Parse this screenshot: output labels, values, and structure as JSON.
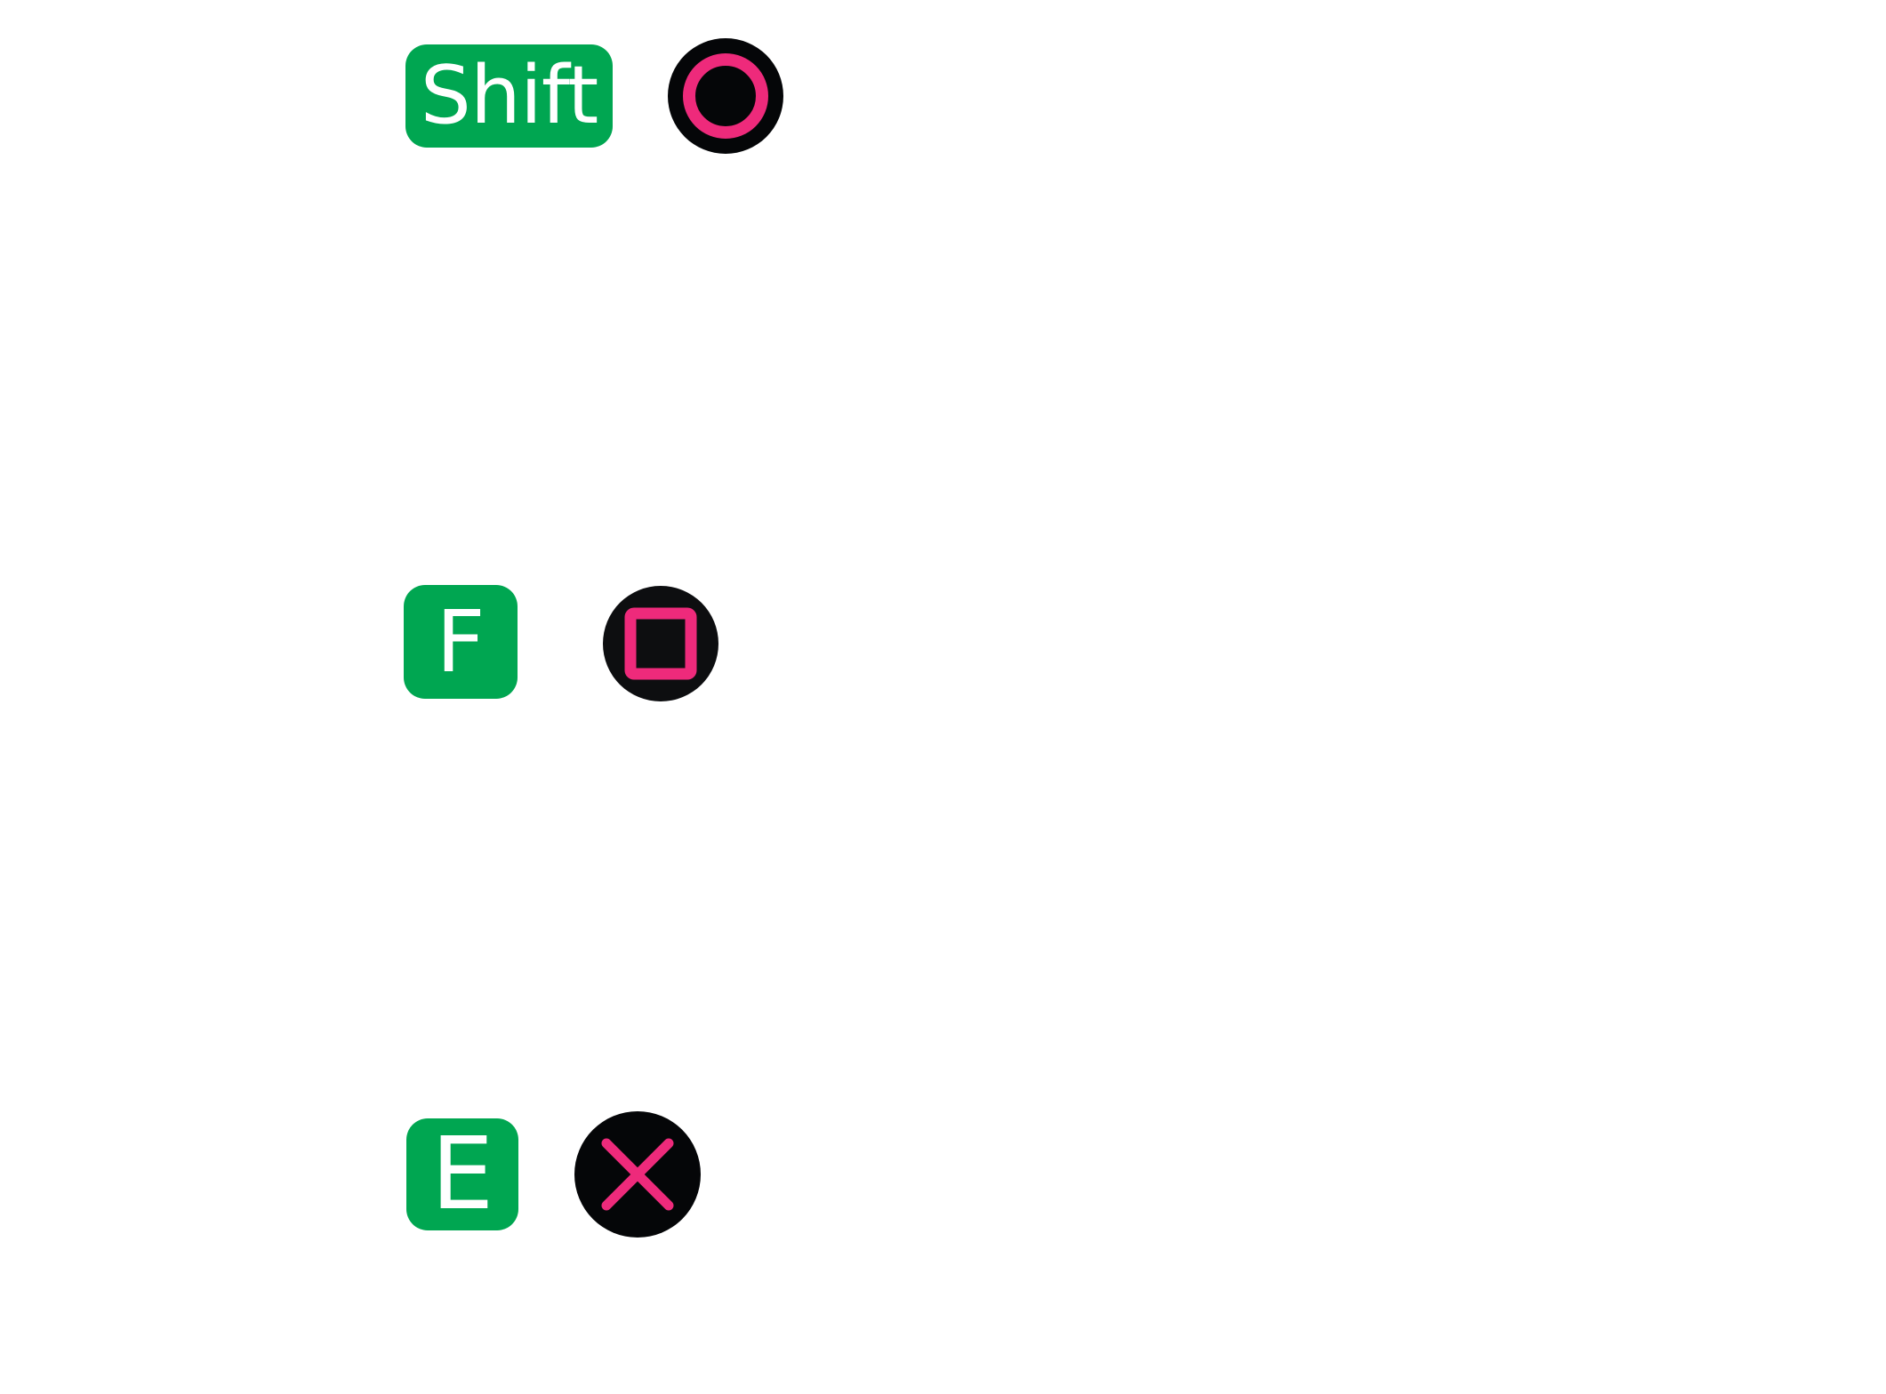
{
  "bindings": [
    {
      "key_label": "Shift",
      "controller_button": "circle-icon",
      "colors": {
        "key_bg": "#00a651",
        "key_text": "#ffffff",
        "button_bg": "#050608",
        "symbol": "#ee2a7b"
      }
    },
    {
      "key_label": "F",
      "controller_button": "square-icon",
      "colors": {
        "key_bg": "#00a651",
        "key_text": "#ffffff",
        "button_bg": "#0d0e10",
        "symbol": "#ee2a7b"
      }
    },
    {
      "key_label": "E",
      "controller_button": "cross-icon",
      "colors": {
        "key_bg": "#00a651",
        "key_text": "#ffffff",
        "button_bg": "#050608",
        "symbol": "#ee2a7b"
      }
    }
  ]
}
